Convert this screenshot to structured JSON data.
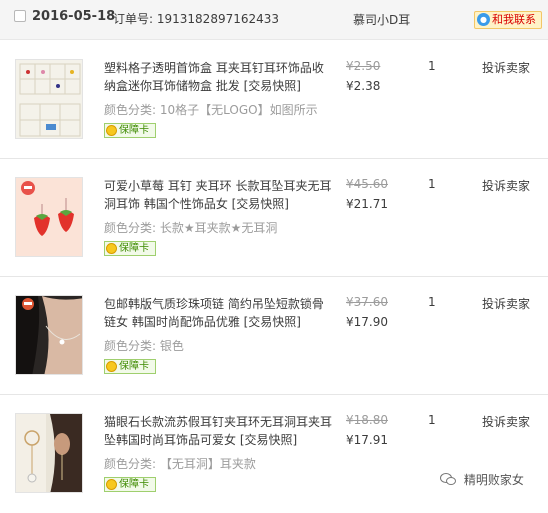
{
  "order": {
    "date": "2016-05-18",
    "order_label": "订单号:",
    "order_number": "1913182897162433",
    "shop": "慕司小D耳",
    "contact_label": "和我联系"
  },
  "items": [
    {
      "title": "塑料格子透明首饰盒 耳夹耳钉耳环饰品收纳盒迷你耳饰储物盒 批发 [交易快照]",
      "sku": "颜色分类: 10格子【无LOGO】如图所示",
      "badge": "保障卡",
      "original_price": "¥2.50",
      "price": "¥2.38",
      "quantity": "1",
      "action": "投诉卖家"
    },
    {
      "title": "可爱小草莓 耳钉 夹耳环 长款耳坠耳夹无耳洞耳饰 韩国个性饰品女 [交易快照]",
      "sku": "颜色分类: 长款★耳夹款★无耳洞",
      "badge": "保障卡",
      "original_price": "¥45.60",
      "price": "¥21.71",
      "quantity": "1",
      "action": "投诉卖家"
    },
    {
      "title": "包邮韩版气质珍珠项链 简约吊坠短款锁骨链女 韩国时尚配饰品优雅 [交易快照]",
      "sku": "颜色分类: 银色",
      "badge": "保障卡",
      "original_price": "¥37.60",
      "price": "¥17.90",
      "quantity": "1",
      "action": "投诉卖家"
    },
    {
      "title": "猫眼石长款流苏假耳钉夹耳环无耳洞耳夹耳坠韩国时尚耳饰品可爱女 [交易快照]",
      "sku": "颜色分类: 【无耳洞】耳夹款",
      "badge": "保障卡",
      "original_price": "¥18.80",
      "price": "¥17.91",
      "quantity": "1",
      "action": "投诉卖家"
    }
  ],
  "watermark": "精明败家女"
}
